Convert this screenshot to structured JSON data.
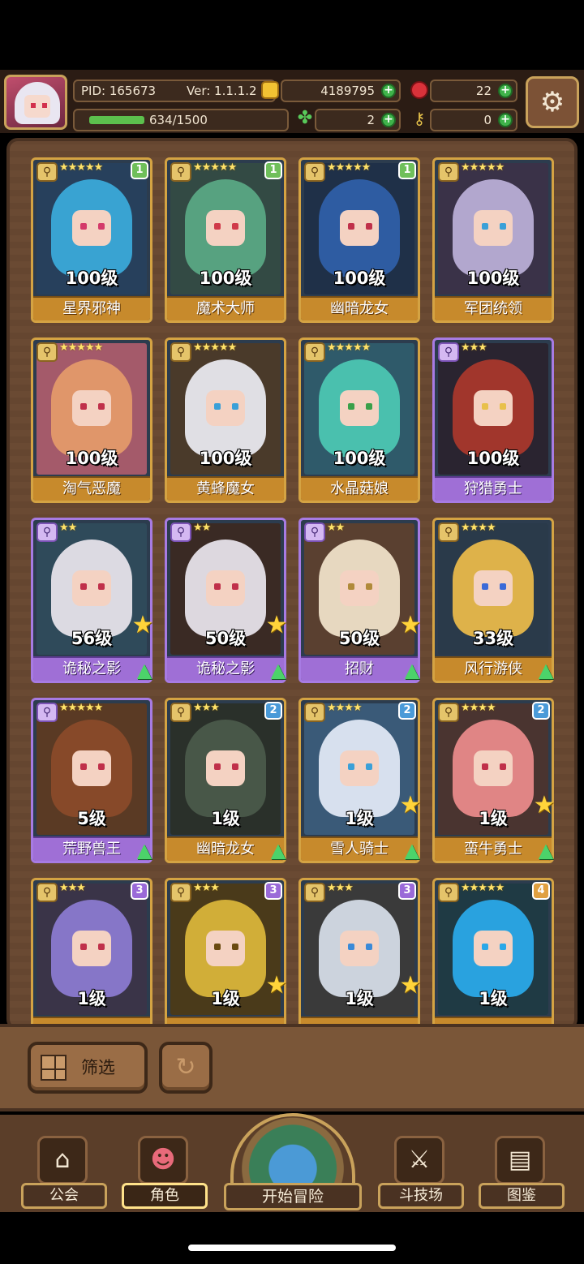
{
  "hud": {
    "pid": "PID: 165673",
    "version": "Ver: 1.1.1.2",
    "gold": "4189795",
    "gems": "22",
    "exp": "634/1500",
    "exp_progress": 0.4227,
    "clover": "2",
    "keys": "0"
  },
  "heroes": [
    {
      "level": "100级",
      "name": "星界邪神",
      "stars": "★★★★★",
      "tier": "1",
      "frame": "gold",
      "hair": "#3aa9d8",
      "eye": "#d43a6a",
      "bg": "#27405c"
    },
    {
      "level": "100级",
      "name": "魔术大师",
      "stars": "★★★★★",
      "tier": "1",
      "frame": "gold",
      "hair": "#5aa684",
      "eye": "#d03a4a",
      "bg": "#334a44"
    },
    {
      "level": "100级",
      "name": "幽暗龙女",
      "stars": "★★★★★",
      "tier": "1",
      "frame": "gold",
      "hair": "#2f5fa8",
      "eye": "#c0304a",
      "bg": "#1f3048"
    },
    {
      "level": "100级",
      "name": "军团统领",
      "stars": "★★★★★",
      "tier": "",
      "frame": "gold",
      "hair": "#b8aed6",
      "eye": "#3aa0d8",
      "bg": "#3a3248"
    },
    {
      "level": "100级",
      "name": "淘气恶魔",
      "stars": "★★★★★",
      "tier": "",
      "frame": "gold",
      "hair": "#e49a6a",
      "eye": "#c0304a",
      "bg": "#a45a6a"
    },
    {
      "level": "100级",
      "name": "黄蜂魔女",
      "stars": "★★★★★",
      "tier": "",
      "frame": "gold",
      "hair": "#e8e8ee",
      "eye": "#3aa0d8",
      "bg": "#4a3a2a"
    },
    {
      "level": "100级",
      "name": "水晶菇娘",
      "stars": "★★★★★",
      "tier": "",
      "frame": "gold",
      "hair": "#4cc6b2",
      "eye": "#3aa04a",
      "bg": "#2f5a6a"
    },
    {
      "level": "100级",
      "name": "狩猎勇士",
      "stars": "★★★",
      "tier": "",
      "frame": "purple",
      "hair": "#a8382c",
      "eye": "#e8c04a",
      "bg": "#2a2430"
    },
    {
      "level": "56级",
      "name": "诡秘之影",
      "stars": "★★",
      "tier": "",
      "frame": "purple",
      "hair": "#e6e2ea",
      "eye": "#c0304a",
      "bg": "#2f4a5a"
    },
    {
      "level": "50级",
      "name": "诡秘之影",
      "stars": "★★",
      "tier": "",
      "frame": "purple",
      "hair": "#e6e2ea",
      "eye": "#c0304a",
      "bg": "#3a2a24"
    },
    {
      "level": "50级",
      "name": "招财",
      "stars": "★★",
      "tier": "",
      "frame": "purple",
      "hair": "#efe0c8",
      "eye": "#b08a3a",
      "bg": "#5a4030"
    },
    {
      "level": "33级",
      "name": "风行游侠",
      "stars": "★★★★",
      "tier": "",
      "frame": "gold",
      "hair": "#e8b84a",
      "eye": "#3a6ad8",
      "bg": "#2a3a4a"
    },
    {
      "level": "5级",
      "name": "荒野兽王",
      "stars": "★★★★★",
      "tier": "",
      "frame": "purple",
      "hair": "#8a4a2a",
      "eye": "#c0304a",
      "bg": "#5a3a24"
    },
    {
      "level": "1级",
      "name": "幽暗龙女",
      "stars": "★★★",
      "tier": "2",
      "frame": "gold",
      "hair": "#4a5a4a",
      "eye": "#c0304a",
      "bg": "#2a302a"
    },
    {
      "level": "1级",
      "name": "雪人骑士",
      "stars": "★★★★",
      "tier": "2",
      "frame": "gold",
      "hair": "#dfe8f4",
      "eye": "#3aa0d8",
      "bg": "#3a5a78"
    },
    {
      "level": "1级",
      "name": "蛮牛勇士",
      "stars": "★★★★",
      "tier": "2",
      "frame": "gold",
      "hair": "#e88a8a",
      "eye": "#c0304a",
      "bg": "#4a3430"
    },
    {
      "level": "1级",
      "name": "",
      "stars": "★★★",
      "tier": "3",
      "frame": "gold",
      "hair": "#8a7ad0",
      "eye": "#c0304a",
      "bg": "#3a3448"
    },
    {
      "level": "1级",
      "name": "",
      "stars": "★★★",
      "tier": "3",
      "frame": "gold",
      "hair": "#d8b43a",
      "eye": "#6a4a10",
      "bg": "#4a3a1a"
    },
    {
      "level": "1级",
      "name": "",
      "stars": "★★★",
      "tier": "3",
      "frame": "gold",
      "hair": "#d4dbe6",
      "eye": "#3a8ad8",
      "bg": "#3a3a3a"
    },
    {
      "level": "1级",
      "name": "",
      "stars": "★★★★★",
      "tier": "4",
      "frame": "gold",
      "hair": "#2aa8e8",
      "eye": "#2aa8e8",
      "bg": "#1f3a44"
    }
  ],
  "filter": {
    "label": "筛选"
  },
  "nav": {
    "guild": "公会",
    "character": "角色",
    "adventure": "开始冒险",
    "arena": "斗技场",
    "codex": "图鉴"
  },
  "colors": {
    "tier1": "#6fbf5a",
    "tier2": "#4a9ad8",
    "tier3": "#9a6ad8",
    "tier4": "#e0a040"
  }
}
